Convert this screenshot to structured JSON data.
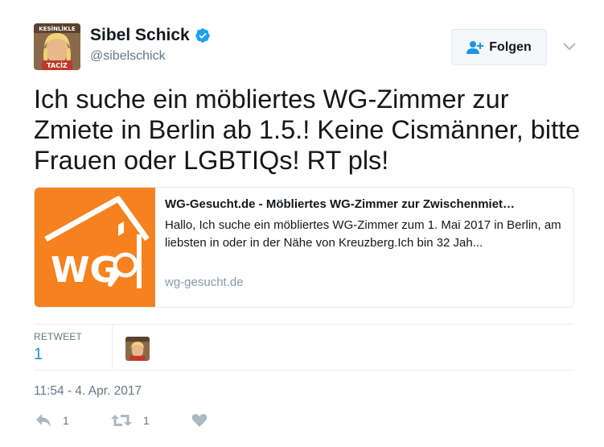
{
  "user": {
    "display_name": "Sibel Schick",
    "handle": "@sibelschick",
    "verified_icon": "verified-badge-icon",
    "avatar_text_top": "KESİNLİKLE",
    "avatar_text_bottom": "TACİZ"
  },
  "follow_button": {
    "label": "Folgen",
    "icon": "add-user-icon"
  },
  "tweet": {
    "text": "Ich suche ein möbliertes WG-Zimmer zur Zmiete in Berlin ab 1.5.! Keine Cismänner, bitte Frauen oder LGBTIQs! RT pls!"
  },
  "card": {
    "title": "WG-Gesucht.de - Möbliertes WG-Zimmer zur Zwischenmiet…",
    "description": "Hallo, Ich suche ein möbliertes WG-Zimmer zum 1. Mai 2017 in Berlin, am liebsten in oder in der Nähe von Kreuzberg.Ich bin 32 Jah...",
    "domain": "wg-gesucht.de",
    "thumb_text": "WG"
  },
  "stats": {
    "retweet_label": "RETWEET",
    "retweet_count": "1"
  },
  "timestamp": "11:54 - 4. Apr. 2017",
  "actions": {
    "reply_count": "1",
    "retweet_count": "1"
  },
  "colors": {
    "accent": "#1b95e0",
    "muted": "#657786",
    "wg_orange": "#f5821f",
    "verified": "#1da1f2"
  }
}
